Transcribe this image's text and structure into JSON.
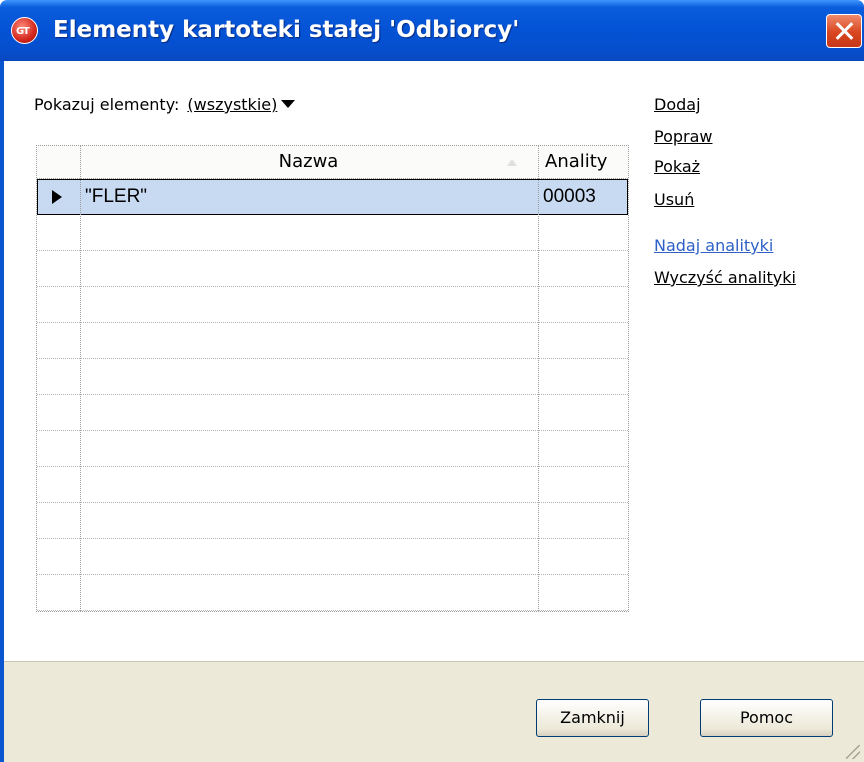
{
  "window": {
    "title": "Elementy kartoteki stałej 'Odbiorcy'",
    "app_icon_text": "GT"
  },
  "filter": {
    "label": "Pokazuj elementy:",
    "value": "(wszystkie)"
  },
  "grid": {
    "columns": [
      "Nazwa",
      "Anality"
    ],
    "rows": [
      {
        "nazwa": "\"FLER\"",
        "analityka": "00003",
        "selected": true
      }
    ]
  },
  "actions": {
    "dodaj": "Dodaj",
    "popraw": "Popraw",
    "pokaz": "Pokaż",
    "usun": "Usuń",
    "nadaj": "Nadaj analityki",
    "wyczysc": "Wyczyść analityki"
  },
  "buttons": {
    "close": "Zamknij",
    "help": "Pomoc"
  },
  "colors": {
    "title_bar": "#0553d6",
    "selected_row": "#c8d9f2",
    "link": "#2e60c8",
    "footer": "#ece9d8"
  }
}
